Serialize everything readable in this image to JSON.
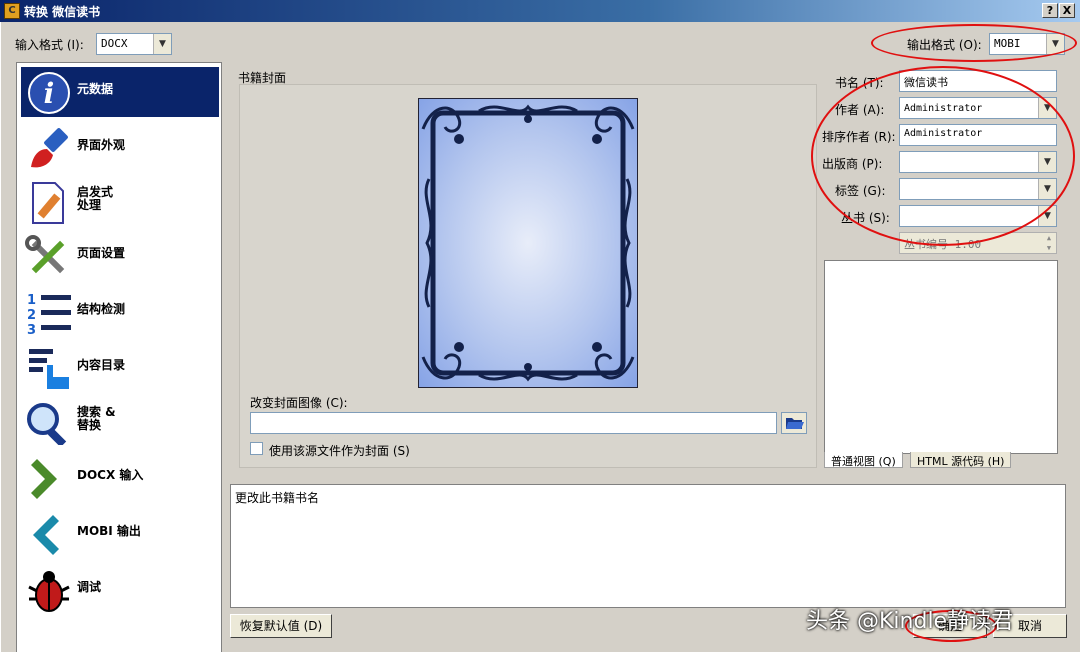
{
  "title": "转换 微信读书",
  "titlebar": {
    "help": "?",
    "close": "X"
  },
  "input_format": {
    "label": "输入格式 (I):",
    "value": "DOCX"
  },
  "output_format": {
    "label": "输出格式 (O):",
    "value": "MOBI"
  },
  "sidebar": {
    "items": [
      {
        "label": "元数据",
        "icon": "info-icon"
      },
      {
        "label": "界面外观",
        "icon": "brush-icon"
      },
      {
        "label": "启发式\n处理",
        "icon": "document-pencil-icon"
      },
      {
        "label": "页面设置",
        "icon": "tools-icon"
      },
      {
        "label": "结构检测",
        "icon": "numbered-list-icon"
      },
      {
        "label": "内容目录",
        "icon": "toc-icon"
      },
      {
        "label": "搜索 &\n替换",
        "icon": "magnifier-icon"
      },
      {
        "label": "DOCX 输入",
        "icon": "arrow-right-icon"
      },
      {
        "label": "MOBI 输出",
        "icon": "arrow-left-icon"
      },
      {
        "label": "调试",
        "icon": "bug-icon"
      }
    ]
  },
  "cover": {
    "group_label": "书籍封面",
    "change_label": "改变封面图像 (C):",
    "path_value": "",
    "use_source_label": "使用该源文件作为封面 (S)"
  },
  "metadata": {
    "title_label": "书名 (T):",
    "title_value": "微信读书",
    "author_label": "作者 (A):",
    "author_value": "Administrator",
    "sort_label": "排序作者 (R):",
    "sort_value": "Administrator",
    "publisher_label": "出版商 (P):",
    "publisher_value": "",
    "tags_label": "标签 (G):",
    "tags_value": "",
    "series_label": "丛书 (S):",
    "series_value": "",
    "series_index": "丛书编号 1.00"
  },
  "comments_tabs": {
    "normal": "普通视图 (Q)",
    "html": "HTML 源代码 (H)"
  },
  "help_text": "更改此书籍书名",
  "buttons": {
    "restore": "恢复默认值 (D)",
    "ok": "确定",
    "cancel": "取消"
  },
  "watermark": "头条 @Kindle静读君",
  "colors": {
    "selection": "#0a246a",
    "annotation": "#e01010",
    "cover": "#86a3e6"
  }
}
